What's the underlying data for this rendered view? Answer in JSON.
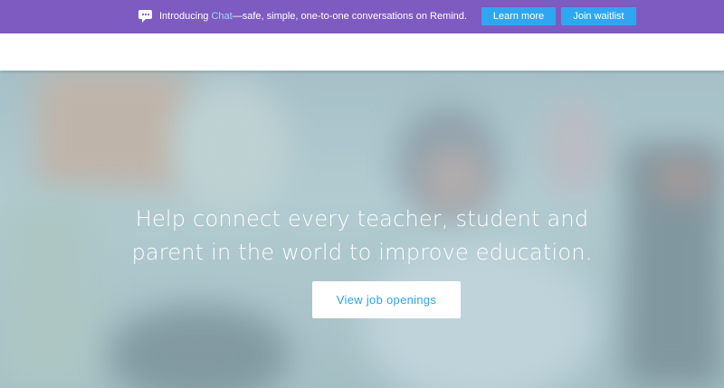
{
  "banner": {
    "intro_prefix": "Introducing ",
    "intro_highlight": "Chat",
    "intro_suffix": "—safe, simple, one-to-one conversations on Remind.",
    "learn_more_label": "Learn more",
    "join_waitlist_label": "Join waitlist",
    "icon": "chat-bubble-icon",
    "background_color": "#7e5bc0",
    "highlight_color": "#9fd4ff",
    "button_color": "#2fa7f0"
  },
  "hero": {
    "headline_line1": "Help connect every teacher, student and",
    "headline_line2": "parent in the world to improve education.",
    "cta_label": "View job openings",
    "cta_text_color": "#2aa5ea"
  }
}
